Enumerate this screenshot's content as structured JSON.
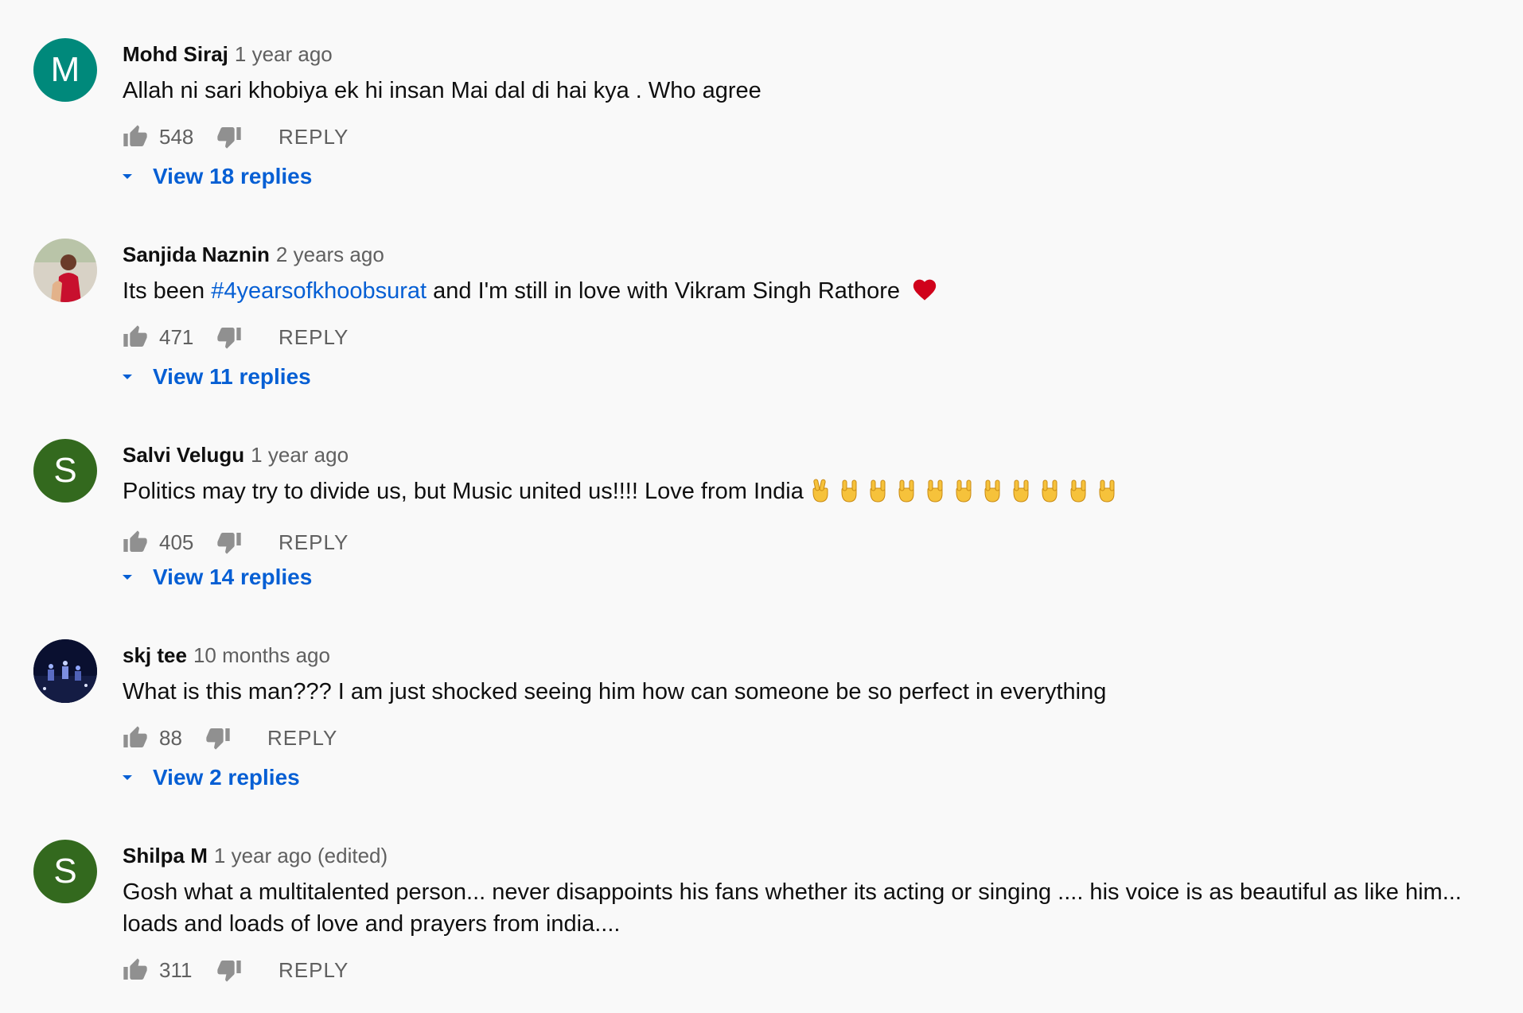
{
  "labels": {
    "reply": "REPLY"
  },
  "colors": {
    "link": "#065fd4",
    "meta": "#606060",
    "avatar_teal": "#00897b",
    "avatar_green": "#33691e"
  },
  "comments": [
    {
      "author": "Mohd Siraj",
      "time": "1 year ago",
      "avatar_letter": "M",
      "text": "Allah ni sari khobiya ek hi insan Mai dal di hai kya . Who agree",
      "likes": "548",
      "view_replies": "View 18 replies"
    },
    {
      "author": "Sanjida Naznin",
      "time": "2 years ago",
      "avatar_icon": "user-photo",
      "text_before": "Its been ",
      "hashtag": "#4yearsofkhoobsurat",
      "text_after": " and I'm still in love with Vikram Singh Rathore",
      "emoji": "heart-icon",
      "likes": "471",
      "view_replies": "View 11 replies"
    },
    {
      "author": "Salvi Velugu",
      "time": "1 year ago",
      "avatar_letter": "S",
      "text": "Politics may try to divide us, but Music united us!!!! Love from India",
      "emojis": [
        "victory-hand-icon",
        "rock-on-hand-icon",
        "rock-on-hand-icon",
        "rock-on-hand-icon",
        "rock-on-hand-icon",
        "rock-on-hand-icon",
        "rock-on-hand-icon",
        "rock-on-hand-icon",
        "rock-on-hand-icon",
        "rock-on-hand-icon",
        "rock-on-hand-icon"
      ],
      "likes": "405",
      "view_replies": "View 14 replies"
    },
    {
      "author": "skj tee",
      "time": "10 months ago",
      "avatar_icon": "concert-photo",
      "text": "What is this man??? I am just shocked seeing him how can someone be so perfect in everything",
      "likes": "88",
      "view_replies": "View 2 replies"
    },
    {
      "author": "Shilpa M",
      "time": "1 year ago (edited)",
      "avatar_letter": "S",
      "text": "Gosh what a multitalented person... never disappoints his fans whether its acting or singing .... his voice is as beautiful as like him...  loads and loads of love and prayers from india....",
      "likes": "311"
    }
  ]
}
